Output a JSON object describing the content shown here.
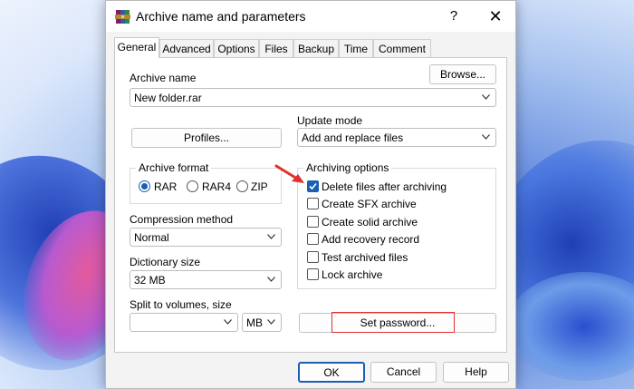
{
  "window": {
    "title": "Archive name and parameters",
    "help_label": "?",
    "close_label": "✕"
  },
  "tabs": [
    "General",
    "Advanced",
    "Options",
    "Files",
    "Backup",
    "Time",
    "Comment"
  ],
  "archive_name": {
    "label": "Archive name",
    "value": "New folder.rar",
    "browse_label": "Browse..."
  },
  "profiles_label": "Profiles...",
  "update_mode": {
    "label": "Update mode",
    "value": "Add and replace files"
  },
  "archive_format": {
    "label": "Archive format",
    "options": [
      "RAR",
      "RAR4",
      "ZIP"
    ],
    "selected": "RAR"
  },
  "compression": {
    "label": "Compression method",
    "value": "Normal"
  },
  "dictionary": {
    "label": "Dictionary size",
    "value": "32 MB"
  },
  "split": {
    "label": "Split to volumes, size",
    "value": "",
    "unit": "MB"
  },
  "archiving_options": {
    "label": "Archiving options",
    "items": [
      {
        "label": "Delete files after archiving",
        "checked": true
      },
      {
        "label": "Create SFX archive",
        "checked": false
      },
      {
        "label": "Create solid archive",
        "checked": false
      },
      {
        "label": "Add recovery record",
        "checked": false
      },
      {
        "label": "Test archived files",
        "checked": false
      },
      {
        "label": "Lock archive",
        "checked": false
      }
    ]
  },
  "set_password_label": "Set password...",
  "footer": {
    "ok_label": "OK",
    "cancel_label": "Cancel",
    "help_label": "Help"
  },
  "colors": {
    "accent": "#1a5fb4",
    "highlight": "#e03030"
  }
}
